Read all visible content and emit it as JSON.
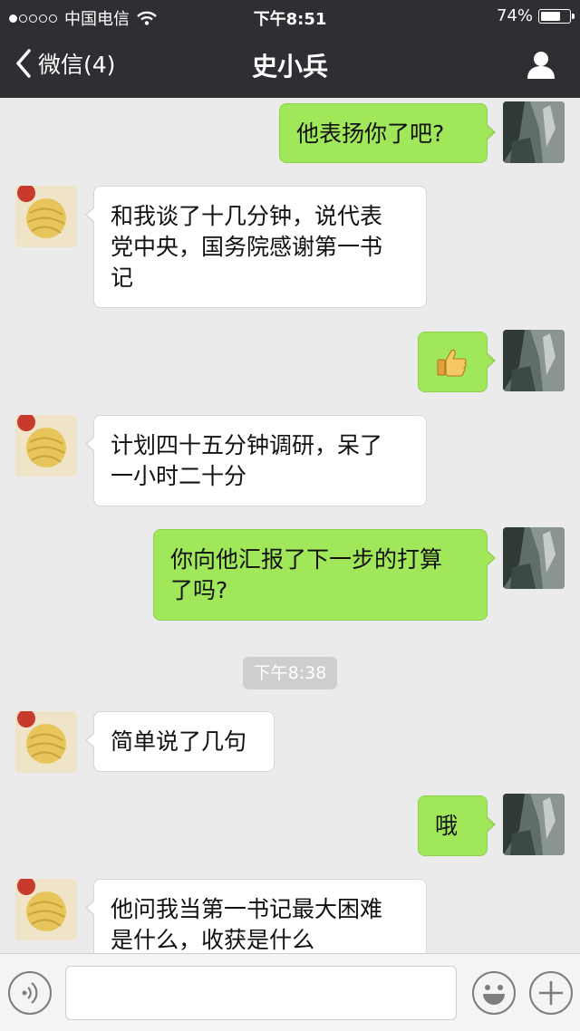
{
  "status_bar": {
    "signal_dots": [
      true,
      false,
      false,
      false,
      false
    ],
    "carrier": "中国电信",
    "time": "下午8:51",
    "battery_text": "74%",
    "battery_level": 0.74
  },
  "nav": {
    "back_label": "微信(4)",
    "title": "史小兵"
  },
  "messages": [
    {
      "side": "out",
      "text": "他表扬你了吧?"
    },
    {
      "side": "in",
      "lines": [
        "和我谈了十几分钟，说代表",
        "党中央，国务院感谢第一书",
        "记"
      ]
    },
    {
      "side": "out",
      "emoji": "thumbs-up-emoji"
    },
    {
      "side": "in",
      "lines": [
        "计划四十五分钟调研，呆了",
        "一小时二十分"
      ]
    },
    {
      "side": "out",
      "lines": [
        "你向他汇报了下一步的打算",
        "了吗?"
      ]
    },
    {
      "side": "in",
      "text": "简单说了几句"
    },
    {
      "side": "out",
      "text": "哦"
    },
    {
      "side": "in",
      "lines": [
        "他问我当第一书记最大困难",
        "是什么，收获是什么"
      ]
    }
  ],
  "timestamp": "下午8:38",
  "colors": {
    "nav_bg": "#2e2e33",
    "chat_bg": "#ebebeb",
    "outgoing_bubble": "#a0e75a",
    "incoming_bubble": "#ffffff"
  },
  "input_bar": {
    "voice_icon": "voice-icon",
    "emoji_icon": "smiley-icon",
    "add_icon": "plus-icon",
    "text_value": ""
  }
}
